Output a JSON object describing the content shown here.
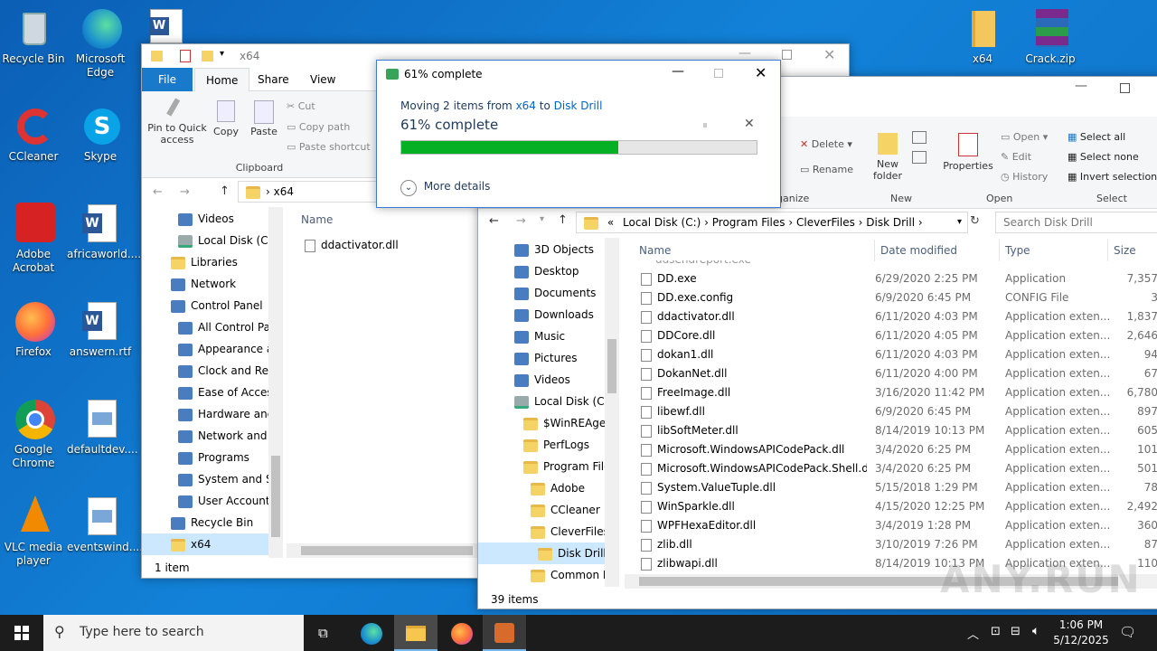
{
  "desktop": {
    "icons": [
      {
        "label": "Recycle Bin",
        "icon": "recycle-bin-icon"
      },
      {
        "label": "Microsoft Edge",
        "icon": "edge-icon"
      },
      {
        "label": "CCleaner",
        "icon": "ccleaner-icon"
      },
      {
        "label": "Skype",
        "icon": "skype-icon"
      },
      {
        "label": "Adobe Acrobat",
        "icon": "acrobat-icon"
      },
      {
        "label": "africaworld....",
        "icon": "word-doc-icon"
      },
      {
        "label": "Firefox",
        "icon": "firefox-icon"
      },
      {
        "label": "answern.rtf",
        "icon": "word-doc-icon"
      },
      {
        "label": "Google Chrome",
        "icon": "chrome-icon"
      },
      {
        "label": "defaultdev....",
        "icon": "image-file-icon"
      },
      {
        "label": "VLC media player",
        "icon": "vlc-icon"
      },
      {
        "label": "eventswind....",
        "icon": "image-file-icon"
      },
      {
        "label": "x64",
        "icon": "folder-icon"
      },
      {
        "label": "Crack.zip",
        "icon": "winrar-icon"
      }
    ]
  },
  "explorer1": {
    "title": "x64",
    "tabs": [
      "File",
      "Home",
      "Share",
      "View"
    ],
    "ribbon": {
      "pin": "Pin to Quick access",
      "copy": "Copy",
      "paste": "Paste",
      "cut": "Cut",
      "copy_path": "Copy path",
      "paste_shortcut": "Paste shortcut",
      "group": "Clipboard"
    },
    "address": "x64",
    "tree": [
      "Videos",
      "Local Disk (C:)",
      "Libraries",
      "Network",
      "Control Panel",
      "All Control Par",
      "Appearance an",
      "Clock and Regi",
      "Ease of Access",
      "Hardware and",
      "Network and Ir",
      "Programs",
      "System and Se",
      "User Accounts",
      "Recycle Bin",
      "x64"
    ],
    "column_name": "Name",
    "files": [
      "ddactivator.dll"
    ],
    "status": "1 item"
  },
  "explorer2": {
    "ribbon": {
      "delete": "Delete",
      "rename": "Rename",
      "new_folder": "New folder",
      "new_group": "New",
      "properties": "Properties",
      "open": "Open",
      "edit": "Edit",
      "history": "History",
      "open_group": "Open",
      "select_all": "Select all",
      "select_none": "Select none",
      "invert_selection": "Invert selection",
      "select_group": "Select",
      "organize": "ganize"
    },
    "breadcrumb": [
      "«",
      "Local Disk (C:)",
      "Program Files",
      "CleverFiles",
      "Disk Drill"
    ],
    "search_placeholder": "Search Disk Drill",
    "tree": [
      "3D Objects",
      "Desktop",
      "Documents",
      "Downloads",
      "Music",
      "Pictures",
      "Videos",
      "Local Disk (C:)",
      "$WinREAgent",
      "PerfLogs",
      "Program Files",
      "Adobe",
      "CCleaner",
      "CleverFiles",
      "Disk Drill",
      "Common Fi"
    ],
    "columns": {
      "name": "Name",
      "date": "Date modified",
      "type": "Type",
      "size": "Size"
    },
    "files": [
      {
        "name": "DD.exe",
        "date": "6/29/2020 2:25 PM",
        "type": "Application",
        "size": "7,357"
      },
      {
        "name": "DD.exe.config",
        "date": "6/9/2020 6:45 PM",
        "type": "CONFIG File",
        "size": "3"
      },
      {
        "name": "ddactivator.dll",
        "date": "6/11/2020 4:03 PM",
        "type": "Application exten...",
        "size": "1,837"
      },
      {
        "name": "DDCore.dll",
        "date": "6/11/2020 4:05 PM",
        "type": "Application exten...",
        "size": "2,646"
      },
      {
        "name": "dokan1.dll",
        "date": "6/11/2020 4:03 PM",
        "type": "Application exten...",
        "size": "94"
      },
      {
        "name": "DokanNet.dll",
        "date": "6/11/2020 4:00 PM",
        "type": "Application exten...",
        "size": "67"
      },
      {
        "name": "FreeImage.dll",
        "date": "3/16/2020 11:42 PM",
        "type": "Application exten...",
        "size": "6,780"
      },
      {
        "name": "libewf.dll",
        "date": "6/9/2020 6:45 PM",
        "type": "Application exten...",
        "size": "897"
      },
      {
        "name": "libSoftMeter.dll",
        "date": "8/14/2019 10:13 PM",
        "type": "Application exten...",
        "size": "605"
      },
      {
        "name": "Microsoft.WindowsAPICodePack.dll",
        "date": "3/4/2020 6:25 PM",
        "type": "Application exten...",
        "size": "101"
      },
      {
        "name": "Microsoft.WindowsAPICodePack.Shell.dll",
        "date": "3/4/2020 6:25 PM",
        "type": "Application exten...",
        "size": "501"
      },
      {
        "name": "System.ValueTuple.dll",
        "date": "5/15/2018 1:29 PM",
        "type": "Application exten...",
        "size": "78"
      },
      {
        "name": "WinSparkle.dll",
        "date": "4/15/2020 12:25 PM",
        "type": "Application exten...",
        "size": "2,492"
      },
      {
        "name": "WPFHexaEditor.dll",
        "date": "3/4/2019 1:28 PM",
        "type": "Application exten...",
        "size": "360"
      },
      {
        "name": "zlib.dll",
        "date": "3/10/2019 7:26 PM",
        "type": "Application exten...",
        "size": "87"
      },
      {
        "name": "zlibwapi.dll",
        "date": "8/14/2019 10:13 PM",
        "type": "Application exten...",
        "size": "110"
      }
    ],
    "status": "39 items"
  },
  "progress": {
    "title": "61% complete",
    "moving_prefix": "Moving 2 items from",
    "from": "x64",
    "to_word": "to",
    "dest": "Disk Drill",
    "heading": "61% complete",
    "percent": 61,
    "more_details": "More details",
    "color": "#06b025"
  },
  "taskbar": {
    "search_placeholder": "Type here to search",
    "time": "1:06 PM",
    "date": "5/12/2025"
  },
  "watermark": "ANY.RUN"
}
